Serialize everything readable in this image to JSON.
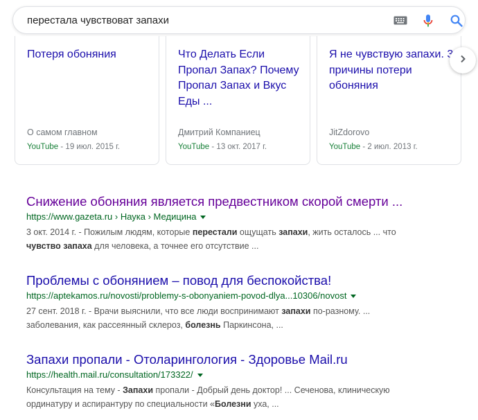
{
  "search": {
    "query": "перестала чувствоват запахи"
  },
  "icons": {
    "keyboard": "keyboard-icon",
    "mic": "mic-icon",
    "search": "search-icon",
    "next": "chevron-right-icon"
  },
  "colors": {
    "link": "#1a0dab",
    "visited": "#660099",
    "url": "#006621",
    "video_source": "#188038",
    "mic_blue": "#4285f4",
    "mic_red": "#ea4335"
  },
  "videos": [
    {
      "title": "Потеря обоняния",
      "author": "О самом главном",
      "source": "YouTube",
      "date": " - 19 июл. 2015 г."
    },
    {
      "title": "Что Делать Если Пропал Запах? Почему Пропал Запах и Вкус Еды ...",
      "author": "Дмитрий Компаниец",
      "source": "YouTube",
      "date": " - 13 окт. 2017 г."
    },
    {
      "title": "Я не чувствую запахи. 3 причины потери обоняния",
      "author": "JitZdorovo",
      "source": "YouTube",
      "date": " - 2 июл. 2013 г."
    }
  ],
  "results": [
    {
      "title": "Снижение обоняния является предвестником скорой смерти ...",
      "url": "https://www.gazeta.ru › Наука › Медицина",
      "snippet1": [
        "3 окт. 2014 г. - Пожилым людям, которые ",
        "перестали",
        " ощущать ",
        "запахи",
        ", жить осталось ... что"
      ],
      "snippet2": [
        "",
        "чувство запаха",
        " для человека, а точнее его отсутствие ..."
      ]
    },
    {
      "title": "Проблемы с обонянием – повод для беспокойства!",
      "url": "https://aptekamos.ru/novosti/problemy-s-obonyaniem-povod-dlya...10306/novost",
      "snippet1": [
        "27 сент. 2018 г. - Врачи выяснили, что все люди воспринимают ",
        "запахи",
        " по-разному. ..."
      ],
      "snippet2": [
        "заболевания, как рассеянный склероз, ",
        "болезнь",
        " Паркинсона, ..."
      ]
    },
    {
      "title": "Запахи пропали - Отоларингология - Здоровье Mail.ru",
      "url": "https://health.mail.ru/consultation/173322/",
      "snippet1": [
        "Консультация на тему - ",
        "Запахи",
        " пропали - Добрый день доктор! ... Сеченова, клиническую"
      ],
      "snippet2": [
        "ординатуру и аспирантуру по специальности «",
        "Болезни",
        " уха, ..."
      ]
    }
  ]
}
